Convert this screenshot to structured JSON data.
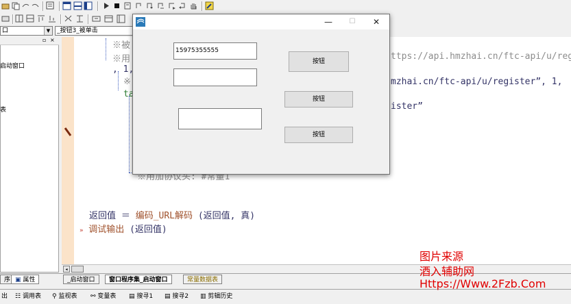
{
  "combo_left": "口",
  "combo_event": "_按钮3_被单击",
  "left_tree": [
    "启动窗口",
    "表"
  ],
  "code_lines": [
    "※被",
    "※用",
    "ttps://api.hmzhai.cn/ftc-api/u/reg",
    ", 1,",
    "※",
    "mzhai.cn/ftc-api/u/register”, 1,",
    "ta",
    "ister”",
    "※用加协议头: #常量1"
  ],
  "code_return": {
    "lhs": "返回值",
    "eq": "＝",
    "func": "编码_URL解码",
    "args": "(返回值, 真)"
  },
  "code_debug": {
    "func": "调试输出",
    "args": "(返回值)"
  },
  "dialog": {
    "edit1": "15975355555",
    "button1": "按钮",
    "button2": "按钮",
    "button3": "按钮",
    "minimize": "—",
    "maximize": "☐",
    "close": "✕"
  },
  "panel_tabs": [
    "序",
    "属性"
  ],
  "editor_tabs": [
    "_启动窗口",
    "窗口程序集_启动窗口",
    "常量数据表"
  ],
  "status_items": [
    "出",
    "调用表",
    "监视表",
    "变量表",
    "搜寻1",
    "搜寻2",
    "剪辑历史"
  ],
  "watermark": {
    "line1": "图片来源",
    "line2": "酒入辅助网",
    "line3": "Https://Www.2Fzb.Com"
  },
  "colors": {
    "gutter": "#fbe3c9",
    "keyword": "#a0522d",
    "watermark": "#e00000"
  }
}
